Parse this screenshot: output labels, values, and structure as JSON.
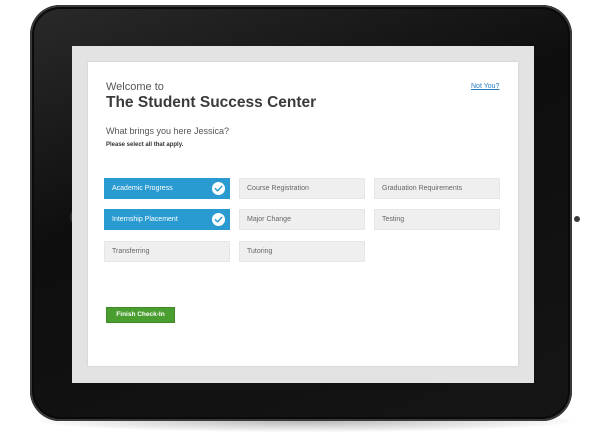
{
  "header": {
    "welcome": "Welcome to",
    "title": "The Student Success Center",
    "not_you": "Not You?"
  },
  "prompt": {
    "question": "What brings you here Jessica?",
    "hint": "Please select all that apply."
  },
  "options": [
    {
      "label": "Academic Progress",
      "selected": true
    },
    {
      "label": "Course Registration",
      "selected": false
    },
    {
      "label": "Graduation Requirements",
      "selected": false
    },
    {
      "label": "Internship Placement",
      "selected": true
    },
    {
      "label": "Major Change",
      "selected": false
    },
    {
      "label": "Testing",
      "selected": false
    },
    {
      "label": "Transferring",
      "selected": false
    },
    {
      "label": "Tutoring",
      "selected": false
    }
  ],
  "actions": {
    "finish_label": "Finish Check-In"
  },
  "colors": {
    "selected": "#2a9bd0",
    "primary_button": "#4a9e2f",
    "link": "#2a7bbf"
  },
  "icons": {
    "selected_indicator": "check-circle-icon"
  }
}
